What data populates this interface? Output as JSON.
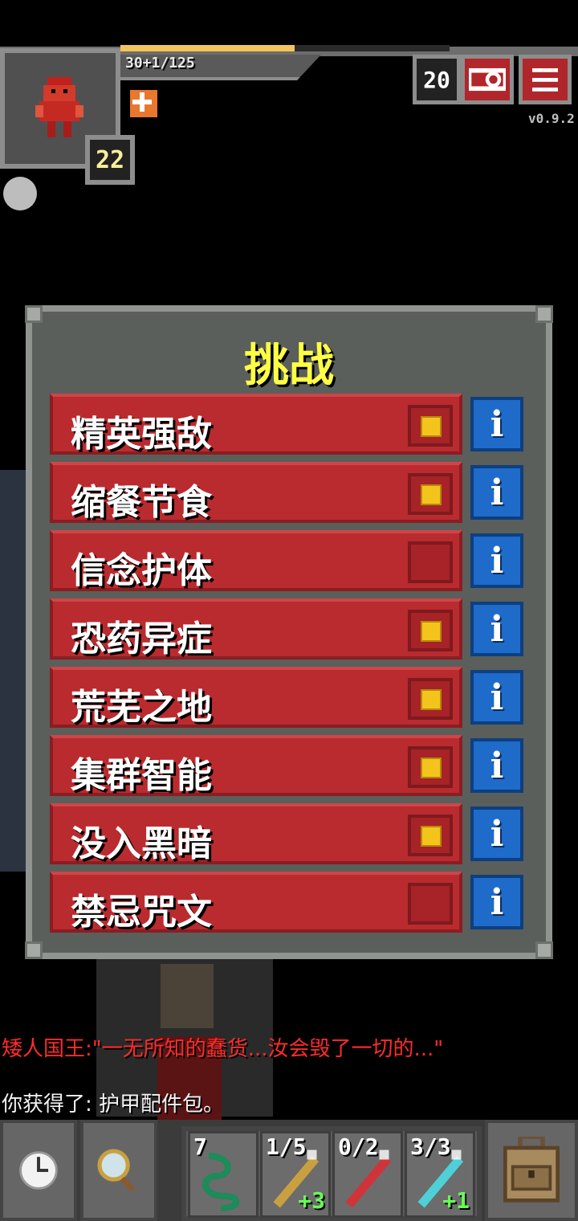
{
  "hud": {
    "exp_text": "30+1/125",
    "hero_level": "22",
    "depth": "20",
    "version": "v0.9.2",
    "health_fraction": 0.53
  },
  "window": {
    "title": "挑战",
    "challenges": [
      {
        "label": "精英强敌",
        "checked": true
      },
      {
        "label": "缩餐节食",
        "checked": true
      },
      {
        "label": "信念护体",
        "checked": false
      },
      {
        "label": "恐药异症",
        "checked": true
      },
      {
        "label": "荒芜之地",
        "checked": true
      },
      {
        "label": "集群智能",
        "checked": true
      },
      {
        "label": "没入黑暗",
        "checked": true
      },
      {
        "label": "禁忌咒文",
        "checked": false
      }
    ],
    "info_label": "i"
  },
  "log": {
    "line1": "矮人国王:\"一无所知的蠢货...汝会毁了一切的...\"",
    "line2": "你获得了: 护甲配件包。"
  },
  "quickslots": [
    {
      "count": "7",
      "bonus": "",
      "icon": "rope-icon",
      "color": "#1f8a5a"
    },
    {
      "count": "1/5",
      "bonus": "+3",
      "icon": "wand-icon",
      "color": "#c9a040"
    },
    {
      "count": "0/2",
      "bonus": "",
      "icon": "fire-wand-icon",
      "color": "#d0343a"
    },
    {
      "count": "3/3",
      "bonus": "+1",
      "icon": "frost-wand-icon",
      "color": "#4fd0d8"
    }
  ],
  "colors": {
    "title": "#ffff44",
    "row": "#b92b2f",
    "info": "#1e6bc9",
    "check": "#f3c51c"
  }
}
